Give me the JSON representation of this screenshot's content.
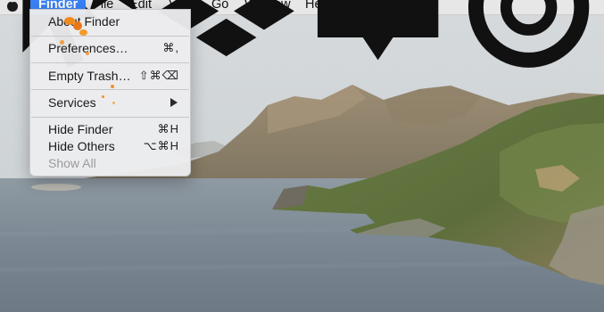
{
  "menubar": {
    "apple_icon": "apple-icon",
    "items": [
      {
        "label": "Finder",
        "active": true
      },
      {
        "label": "File"
      },
      {
        "label": "Edit"
      },
      {
        "label": "View"
      },
      {
        "label": "Go"
      },
      {
        "label": "Window"
      },
      {
        "label": "Help"
      }
    ],
    "status_icons": [
      "cursor-star-icon",
      "dropbox-icon",
      "notification-icon",
      "creative-cloud-icon"
    ]
  },
  "finder_menu": {
    "items": [
      {
        "label": "About Finder",
        "shortcut": ""
      },
      {
        "label": "Preferences…",
        "shortcut": "⌘,"
      },
      {
        "label": "Empty Trash…",
        "shortcut": "⇧⌘⌫"
      },
      {
        "label": "Services",
        "submenu": true
      },
      {
        "label": "Hide Finder",
        "shortcut": "⌘H"
      },
      {
        "label": "Hide Others",
        "shortcut": "⌥⌘H"
      },
      {
        "label": "Show All",
        "disabled": true
      }
    ]
  },
  "colors": {
    "accent": "#3a82f7",
    "menu_bg": "#ececee",
    "disabled_text": "#9b9b9b"
  }
}
